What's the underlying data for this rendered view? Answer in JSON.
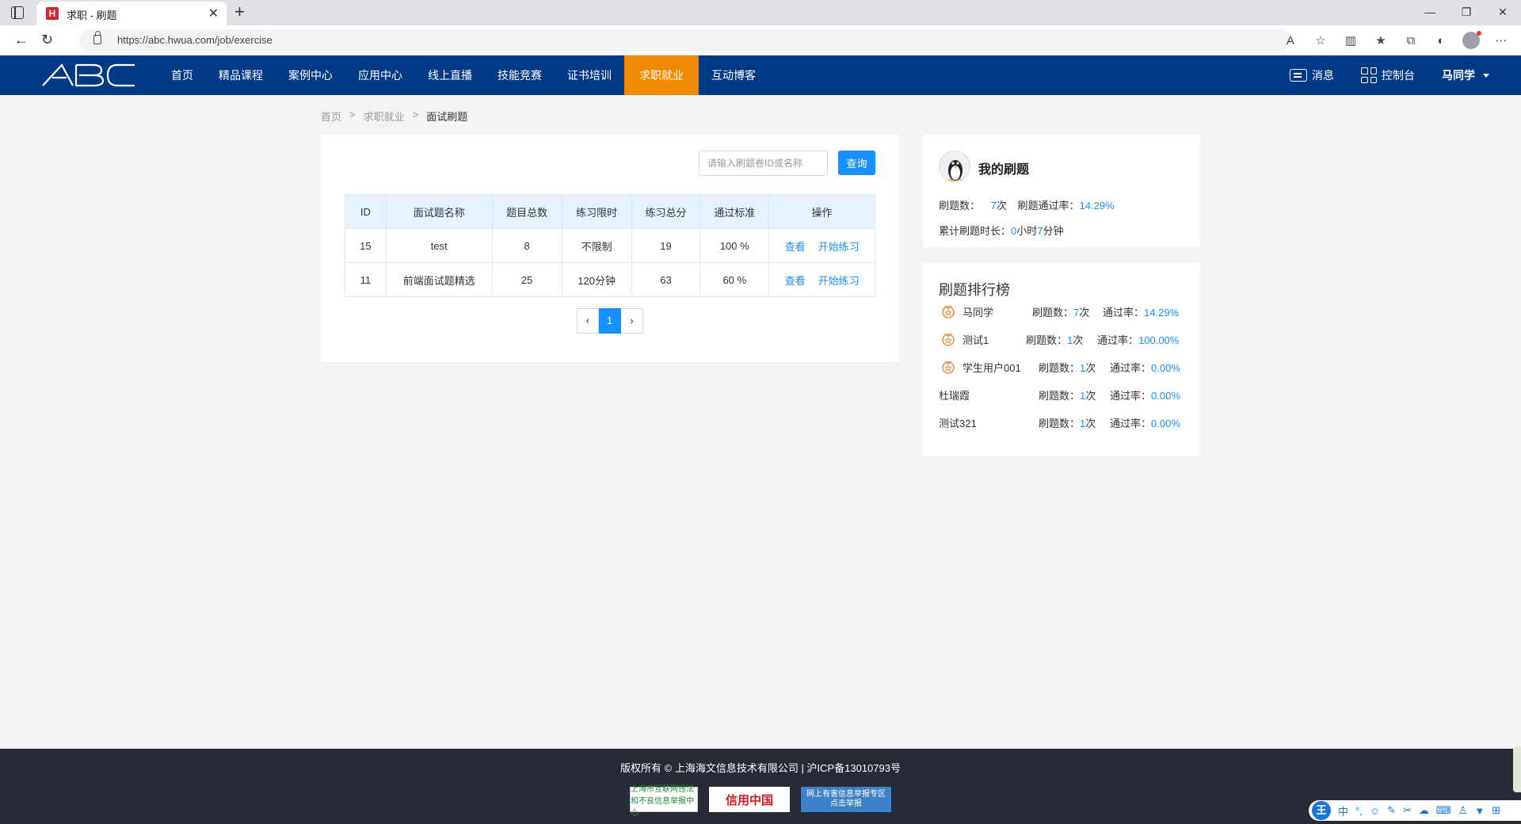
{
  "browser": {
    "tab_title": "求职 - 刷题",
    "tab_favicon_letter": "H",
    "url": "https://abc.hwua.com/job/exercise",
    "new_tab": "+",
    "close_tab": "✕",
    "win_minimize": "—",
    "win_restore": "❐",
    "win_close": "✕"
  },
  "header": {
    "logo_text": "ABC",
    "nav": [
      {
        "label": "首页"
      },
      {
        "label": "精品课程"
      },
      {
        "label": "案例中心"
      },
      {
        "label": "应用中心"
      },
      {
        "label": "线上直播"
      },
      {
        "label": "技能竞赛"
      },
      {
        "label": "证书培训"
      },
      {
        "label": "求职就业",
        "active": true
      },
      {
        "label": "互动博客"
      }
    ],
    "messages_label": "消息",
    "console_label": "控制台",
    "user_label": "马同学"
  },
  "breadcrumb": {
    "items": [
      "首页",
      "求职就业",
      "面试刷题"
    ],
    "separator": ">"
  },
  "search": {
    "placeholder": "请输入刷题卷ID或名称",
    "button_label": "查询"
  },
  "table": {
    "columns": [
      "ID",
      "面试题名称",
      "题目总数",
      "练习限时",
      "练习总分",
      "通过标准",
      "操作"
    ],
    "rows": [
      {
        "id": "15",
        "name": "test",
        "total": "8",
        "limit": "不限制",
        "score": "19",
        "pass": "100 %",
        "view": "查看",
        "start": "开始练习"
      },
      {
        "id": "11",
        "name": "前端面试题精选",
        "total": "25",
        "limit": "120分钟",
        "score": "63",
        "pass": "60 %",
        "view": "查看",
        "start": "开始练习"
      }
    ]
  },
  "pagination": {
    "prev": "‹",
    "current": "1",
    "next": "›"
  },
  "my_exercise": {
    "title": "我的刷题",
    "count_label": "刷题数：",
    "count_value": "7",
    "count_unit": "次",
    "rate_label": "刷题通过率：",
    "rate_value": "14.29",
    "rate_unit": "%",
    "duration_label": "累计刷题时长：",
    "duration_hours": "0",
    "duration_hours_unit": "小时",
    "duration_minutes": "7",
    "duration_minutes_unit": "分钟"
  },
  "ranking": {
    "title": "刷题排行榜",
    "count_label": "刷题数：",
    "count_unit": "次",
    "rate_label": "通过率：",
    "rate_unit": "%",
    "rows": [
      {
        "name": "马同学",
        "count": "7",
        "rate": "14.29",
        "medal": true
      },
      {
        "name": "测试1",
        "count": "1",
        "rate": "100.00",
        "medal": true
      },
      {
        "name": "学生用户001",
        "count": "1",
        "rate": "0.00",
        "medal": true
      },
      {
        "name": "杜瑞霞",
        "count": "1",
        "rate": "0.00",
        "medal": false
      },
      {
        "name": "测试321",
        "count": "1",
        "rate": "0.00",
        "medal": false
      }
    ]
  },
  "footer": {
    "copyright": "版权所有 © 上海海文信息技术有限公司 | 沪ICP备13010793号",
    "badge1": "上海市互联网违法和不良信息举报中心",
    "badge2": "信用中国",
    "badge3_line1": "网上有害信息举报专区",
    "badge3_line2": "点击举报"
  },
  "ime": {
    "logo": "王",
    "mode": "中",
    "punct": "°,"
  },
  "colors": {
    "header_bg": "#003a86",
    "active_nav": "#f08a00",
    "accent_blue": "#1890ff",
    "footer_bg": "#262b35"
  }
}
